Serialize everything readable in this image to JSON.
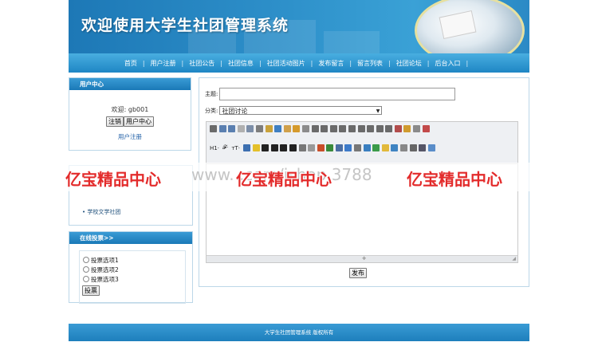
{
  "header": {
    "title": "欢迎使用大学生社团管理系统"
  },
  "nav": {
    "items": [
      "首页",
      "用户注册",
      "社团公告",
      "社团信息",
      "社团活动图片",
      "发布留言",
      "留言列表",
      "社团论坛",
      "后台入口"
    ],
    "separator": "|"
  },
  "user_center": {
    "heading": "用户中心",
    "welcome": "欢迎: gb001",
    "logout_label": "注销",
    "center_label": "用户中心",
    "register_link": "用户注册"
  },
  "club_list": {
    "items": [
      "学校文学社团"
    ]
  },
  "vote": {
    "heading": "在线投票>>",
    "options": [
      "投票选项1",
      "投票选项2",
      "投票选项3"
    ],
    "submit_label": "投票"
  },
  "post_form": {
    "subject_label": "主题:",
    "subject_value": "",
    "category_label": "分类:",
    "category_value": "社团讨论",
    "toolbar_heading": "H1·",
    "toolbar_font": "𝓕·",
    "toolbar_size": "тT·",
    "submit_label": "发布"
  },
  "footer": {
    "text": "大学生社团管理系统 版权所有"
  },
  "watermark": {
    "text": "亿宝精品中心",
    "url_fragment": "www.               .com/ishop  3788"
  },
  "colors": {
    "primary": "#1e86c4",
    "nav_top": "#49aee0",
    "watermark_red": "#e32b2b"
  }
}
